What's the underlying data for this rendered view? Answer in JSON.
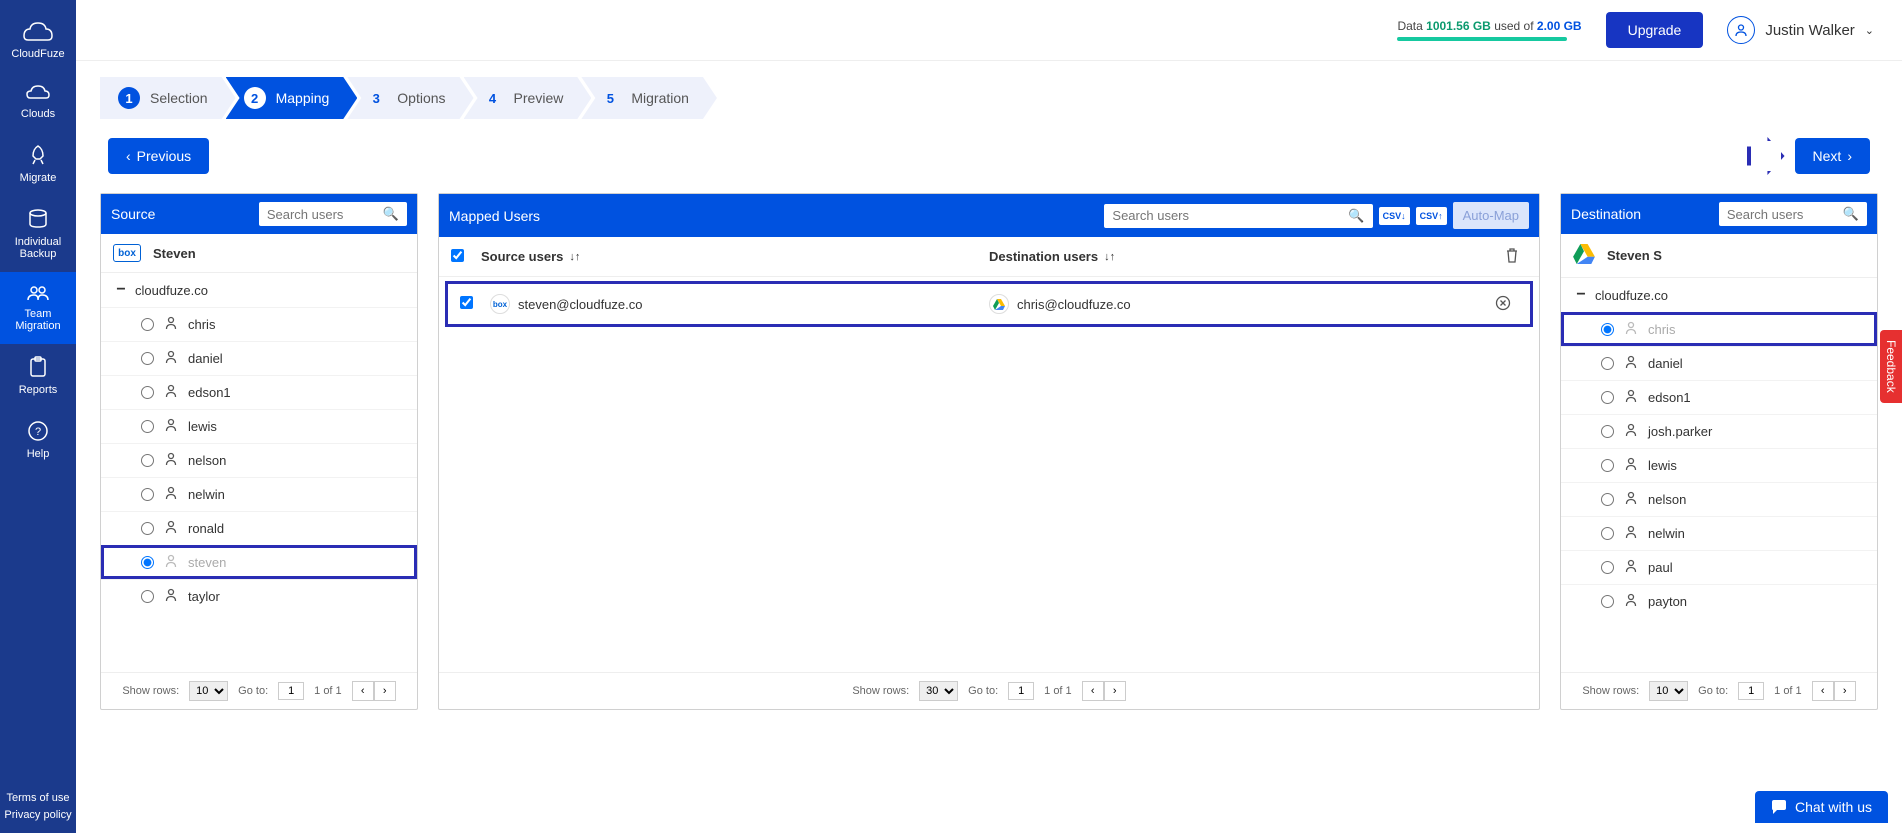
{
  "brand": "CloudFuze",
  "sidebar": {
    "items": [
      {
        "label": "Clouds"
      },
      {
        "label": "Migrate"
      },
      {
        "label": "Individual\nBackup"
      },
      {
        "label": "Team\nMigration"
      },
      {
        "label": "Reports"
      },
      {
        "label": "Help"
      }
    ],
    "footer1": "Terms of use",
    "footer2": "Privacy policy"
  },
  "topbar": {
    "data_prefix": "Data ",
    "used_value": "1001.56 GB",
    "used_middle": " used of ",
    "limit_value": "2.00 GB",
    "upgrade": "Upgrade",
    "user_name": "Justin Walker"
  },
  "steps": [
    {
      "n": "1",
      "label": "Selection"
    },
    {
      "n": "2",
      "label": "Mapping"
    },
    {
      "n": "3",
      "label": "Options"
    },
    {
      "n": "4",
      "label": "Preview"
    },
    {
      "n": "5",
      "label": "Migration"
    }
  ],
  "nav": {
    "previous": "Previous",
    "next": "Next"
  },
  "source": {
    "title": "Source",
    "search_placeholder": "Search users",
    "account": "Steven",
    "domain": "cloudfuze.co",
    "users": [
      "chris",
      "daniel",
      "edson1",
      "lewis",
      "nelson",
      "nelwin",
      "ronald",
      "steven",
      "taylor"
    ],
    "selected": "steven",
    "pager": {
      "show_label": "Show rows:",
      "show_value": "10",
      "goto_label": "Go to:",
      "goto_value": "1",
      "range": "1 of 1"
    }
  },
  "mapped": {
    "title": "Mapped Users",
    "search_placeholder": "Search users",
    "csv1": "CSV↓",
    "csv2": "CSV↑",
    "automap": "Auto-Map",
    "col_source": "Source users",
    "col_dest": "Destination users",
    "rows": [
      {
        "source_email": "steven@cloudfuze.co",
        "dest_email": "chris@cloudfuze.co"
      }
    ],
    "pager": {
      "show_label": "Show rows:",
      "show_value": "30",
      "goto_label": "Go to:",
      "goto_value": "1",
      "range": "1 of 1"
    }
  },
  "destination": {
    "title": "Destination",
    "search_placeholder": "Search users",
    "account": "Steven S",
    "domain": "cloudfuze.co",
    "users": [
      "chris",
      "daniel",
      "edson1",
      "josh.parker",
      "lewis",
      "nelson",
      "nelwin",
      "paul",
      "payton"
    ],
    "selected": "chris",
    "pager": {
      "show_label": "Show rows:",
      "show_value": "10",
      "goto_label": "Go to:",
      "goto_value": "1",
      "range": "1 of 1"
    }
  },
  "feedback": "Feedback",
  "chat": "Chat with us"
}
